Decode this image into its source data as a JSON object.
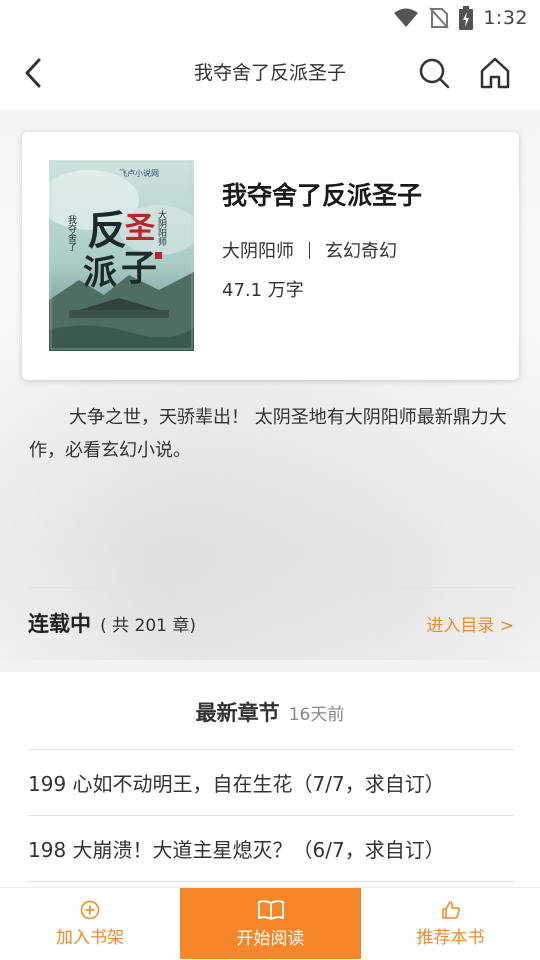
{
  "status_bar": {
    "time": "1:32"
  },
  "nav": {
    "title": "我夺舍了反派圣子"
  },
  "book": {
    "title": "我夺舍了反派圣子",
    "author": "大阴阳师",
    "genre": "玄幻奇幻",
    "word_count": "47.1 万字",
    "cover_text": {
      "title_big": "反派圣子",
      "title_small": "我夺舍了",
      "author": "大阴阳师",
      "publisher": "飞卢小说网"
    },
    "description": "大争之世，天骄辈出！ 太阴圣地有大阴阳师最新鼎力大作，必看玄幻小说。"
  },
  "status_row": {
    "status": "连载中",
    "chapter_count": "( 共 201 章)",
    "toc_link": "进入目录 >"
  },
  "latest": {
    "title": "最新章节",
    "updated": "16天前",
    "chapters": [
      "199 心如不动明王，自在生花（7/7，求自订）",
      "198 大崩溃！大道主星熄灭？（6/7，求自订）"
    ]
  },
  "bottom_bar": {
    "add_shelf": "加入书架",
    "start_read": "开始阅读",
    "recommend": "推荐本书"
  },
  "colors": {
    "accent": "#f08a2a",
    "read_button": "#f5872a"
  },
  "icons": [
    "wifi-icon",
    "no-sim-icon",
    "battery-charging-icon",
    "back-arrow-icon",
    "search-icon",
    "home-icon",
    "add-circle-icon",
    "open-book-icon",
    "thumbs-up-icon"
  ]
}
